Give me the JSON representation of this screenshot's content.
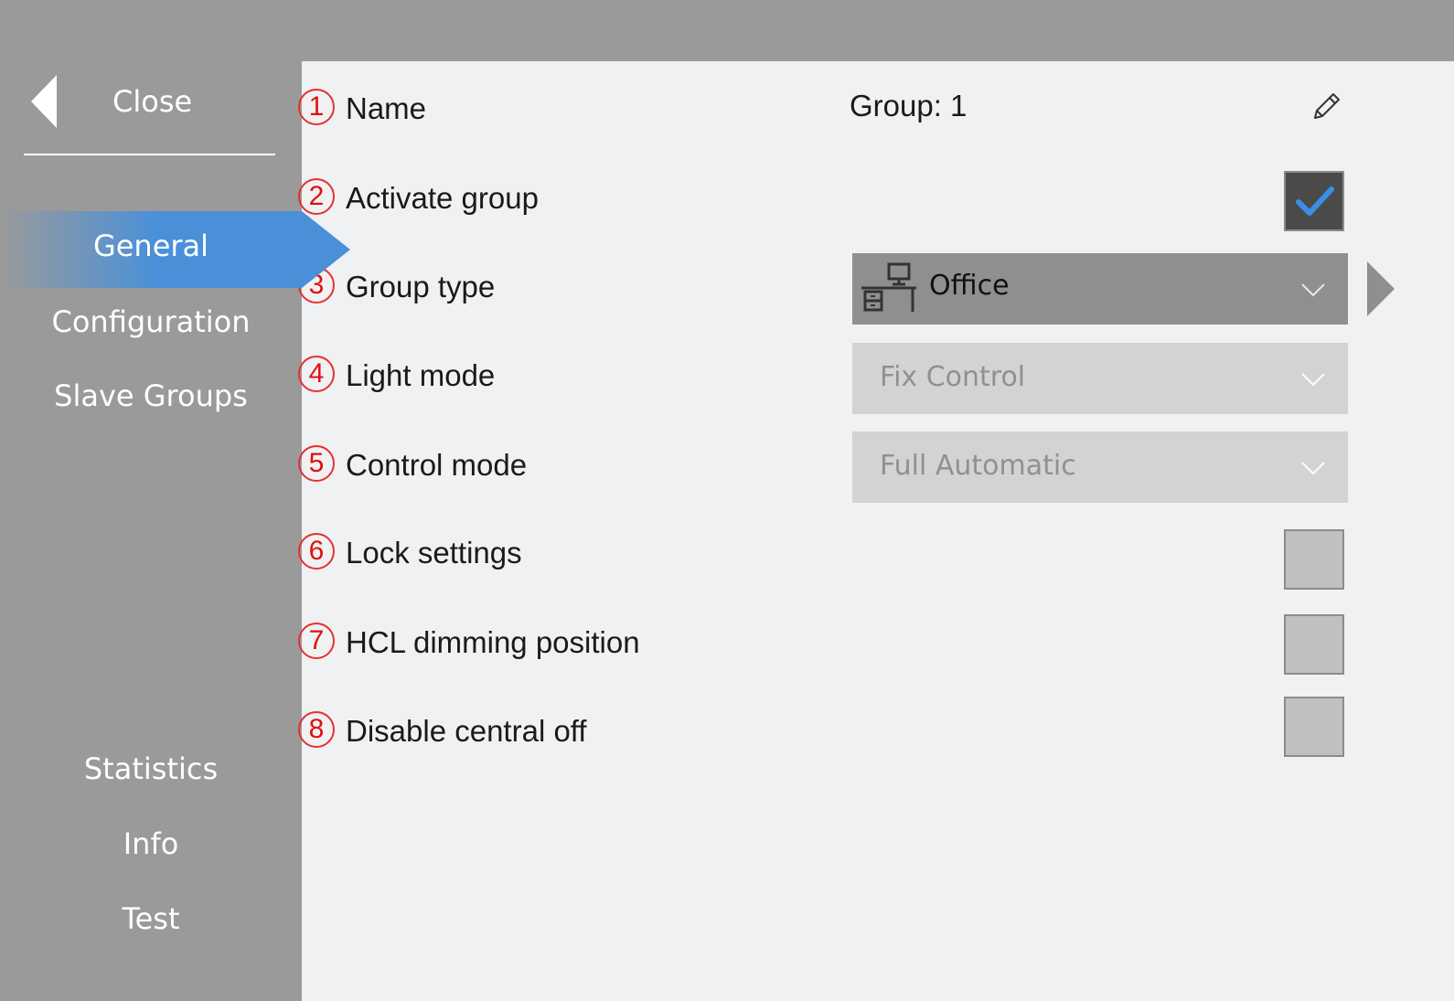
{
  "sidebar": {
    "close_label": "Close",
    "nav": {
      "general": "General",
      "configuration": "Configuration",
      "slave_groups": "Slave Groups",
      "statistics": "Statistics",
      "info": "Info",
      "test": "Test"
    },
    "active_item": "General",
    "active_color": "#4a90d9"
  },
  "settings": {
    "rows": [
      {
        "num": "1",
        "label": "Name"
      },
      {
        "num": "2",
        "label": "Activate group"
      },
      {
        "num": "3",
        "label": "Group type"
      },
      {
        "num": "4",
        "label": "Light mode"
      },
      {
        "num": "5",
        "label": "Control mode"
      },
      {
        "num": "6",
        "label": "Lock settings"
      },
      {
        "num": "7",
        "label": "HCL dimming position"
      },
      {
        "num": "8",
        "label": "Disable central off"
      }
    ],
    "name_value": "Group: 1",
    "activate_group_checked": true,
    "group_type_value": "Office",
    "light_mode_value": "Fix Control",
    "control_mode_value": "Full Automatic",
    "lock_settings_checked": false,
    "hcl_dimming_checked": false,
    "disable_central_off_checked": false
  },
  "icons": {
    "back": "back-arrow-icon",
    "edit": "pencil-icon",
    "check": "checkmark-icon",
    "group_type": "office-desk-icon",
    "dropdown": "chevron-down-icon",
    "next": "chevron-right-icon"
  },
  "colors": {
    "sidebar_bg": "#9a9a9a",
    "main_bg": "#f0f1f3",
    "badge_red": "#e01010",
    "check_blue": "#3a8fe8"
  }
}
